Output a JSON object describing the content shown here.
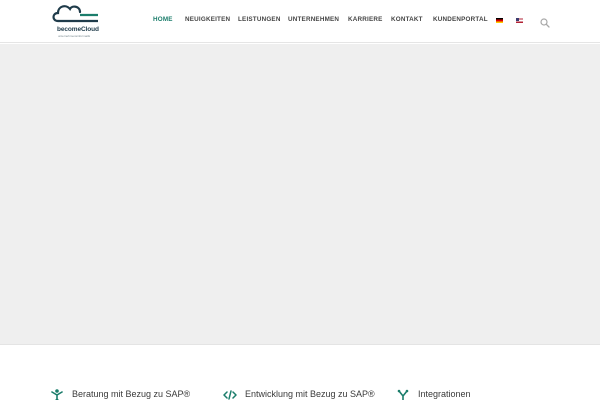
{
  "header": {
    "logo": {
      "name": "becomeCloud",
      "tagline": "unternehmensinformatik",
      "colors": {
        "primary": "#1f3b4a",
        "accent": "#1b7d6b"
      }
    },
    "nav": [
      {
        "label": "HOME",
        "active": true
      },
      {
        "label": "NEUIGKEITEN",
        "active": false
      },
      {
        "label": "LEISTUNGEN",
        "active": false
      },
      {
        "label": "UNTERNEHMEN",
        "active": false
      },
      {
        "label": "KARRIERE",
        "active": false
      },
      {
        "label": "KONTAKT",
        "active": false
      },
      {
        "label": "KUNDENPORTAL",
        "active": false
      }
    ],
    "languages": [
      {
        "code": "de",
        "icon": "flag-de-icon"
      },
      {
        "code": "en-us",
        "icon": "flag-us-icon"
      }
    ],
    "search_icon": "search-icon"
  },
  "hero": {
    "background": "#efefef"
  },
  "features": [
    {
      "label": "Beratung mit Bezug zu SAP®",
      "icon": "person-icon"
    },
    {
      "label": "Entwicklung mit Bezug zu SAP®",
      "icon": "code-icon"
    },
    {
      "label": "Integrationen",
      "icon": "branch-icon"
    }
  ],
  "colors": {
    "accent": "#1b7d6b",
    "nav_text": "#444444"
  }
}
